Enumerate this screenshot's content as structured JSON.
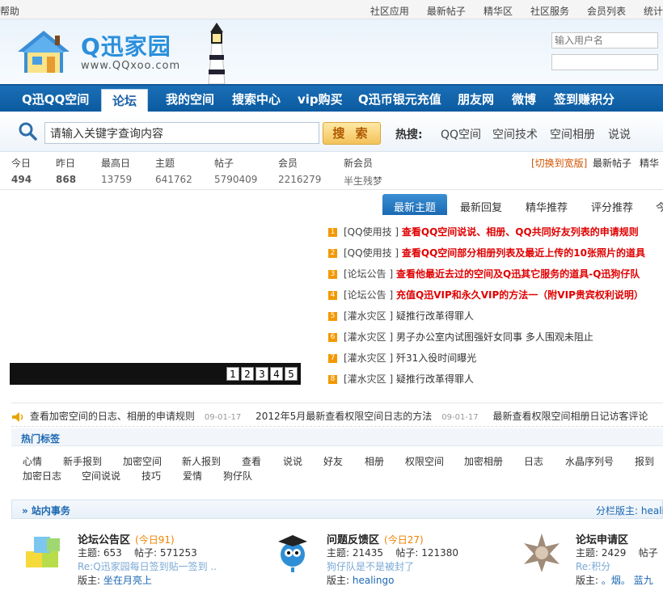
{
  "topbar": {
    "help": "帮助",
    "links": [
      "社区应用",
      "最新帖子",
      "精华区",
      "社区服务",
      "会员列表",
      "统计"
    ]
  },
  "header": {
    "logo_text": "Q迅家园",
    "logo_url": "www.QQxoo.com",
    "username_placeholder": "输入用户名"
  },
  "nav": {
    "items": [
      "Q迅QQ空间",
      "论坛",
      "我的空间",
      "搜索中心",
      "vip购买",
      "Q迅币银元充值",
      "朋友网",
      "微博",
      "签到赚积分"
    ]
  },
  "search": {
    "value": "请输入关键字查询内容",
    "button": "搜 索",
    "hot_label": "热搜:",
    "hot_keywords": [
      "QQ空间",
      "空间技术",
      "空间相册",
      "说说"
    ]
  },
  "stats": {
    "items": [
      {
        "label": "今日",
        "value": "494"
      },
      {
        "label": "昨日",
        "value": "868"
      },
      {
        "label": "最高日",
        "value": "13759"
      },
      {
        "label": "主题",
        "value": "641762"
      },
      {
        "label": "帖子",
        "value": "5790409"
      },
      {
        "label": "会员",
        "value": "2216279"
      },
      {
        "label": "新会员",
        "value": "半生残梦"
      }
    ],
    "switch_wide": "[切换到宽版]",
    "links": [
      "最新帖子",
      "精华"
    ]
  },
  "slider": {
    "pages": [
      "1",
      "2",
      "3",
      "4",
      "5"
    ]
  },
  "tabs": [
    "最新主题",
    "最新回复",
    "精华推荐",
    "评分推荐",
    "今"
  ],
  "news": [
    {
      "num": "1",
      "cat": "[QQ使用技 ]",
      "title": "查看QQ空间说说、相册、QQ共同好友列表的申请规则",
      "red": true
    },
    {
      "num": "2",
      "cat": "[QQ使用技 ]",
      "title": "查看QQ空间部分相册列表及最近上传的10张照片的道具",
      "red": true
    },
    {
      "num": "3",
      "cat": "[论坛公告 ]",
      "title": "查看他最近去过的空间及Q迅其它服务的道具-Q迅狗仔队",
      "red": true
    },
    {
      "num": "4",
      "cat": "[论坛公告 ]",
      "title": "充值Q迅VIP和永久VIP的方法一（附VIP贵宾权利说明）",
      "red": true
    },
    {
      "num": "5",
      "cat": "[灌水灾区 ]",
      "title": "疑推行改革得罪人",
      "red": false
    },
    {
      "num": "6",
      "cat": "[灌水灾区 ]",
      "title": "男子办公室内试图强奸女同事 多人围观未阻止",
      "red": false
    },
    {
      "num": "7",
      "cat": "[灌水灾区 ]",
      "title": "歼31入役时间曝光",
      "red": false
    },
    {
      "num": "8",
      "cat": "[灌水灾区 ]",
      "title": "疑推行改革得罪人",
      "red": false
    }
  ],
  "ticker": [
    {
      "text": "查看加密空间的日志、相册的申请规则",
      "date": "09-01-17"
    },
    {
      "text": "2012年5月最新查看权限空间日志的方法",
      "date": "09-01-17"
    },
    {
      "text": "最新查看权限空间相册日记访客评论",
      "date": ""
    }
  ],
  "hot_tags": {
    "title": "热门标签",
    "row1": [
      "心情",
      "新手报到",
      "加密空间",
      "新人报到",
      "查看",
      "说说",
      "好友",
      "相册",
      "权限空间",
      "加密相册",
      "日志",
      "水晶序列号",
      "报到"
    ],
    "row2": [
      "加密日志",
      "空间说说",
      "技巧",
      "爱情",
      "狗仔队"
    ]
  },
  "section": {
    "title": "» 站内事务",
    "moderator": "分栏版主: heali"
  },
  "forums": [
    {
      "name": "论坛公告区",
      "today": "(今日91)",
      "topics_label": "主题:",
      "topics": "653",
      "posts_label": "帖子:",
      "posts": "571253",
      "last": "Re:Q迅家园每日签到贴一签到 ..",
      "mod_label": "版主:",
      "mod": "坐在月亮上"
    },
    {
      "name": "问题反馈区",
      "today": "(今日27)",
      "topics_label": "主题:",
      "topics": "21435",
      "posts_label": "帖子:",
      "posts": "121380",
      "last": "狗仔队是不是被封了",
      "mod_label": "版主:",
      "mod": "healingo"
    },
    {
      "name": "论坛申请区",
      "today": "",
      "topics_label": "主题:",
      "topics": "2429",
      "posts_label": "帖子",
      "posts": "",
      "last": "Re:积分",
      "mod_label": "版主:",
      "mod": "。烟。 蓝九"
    }
  ]
}
